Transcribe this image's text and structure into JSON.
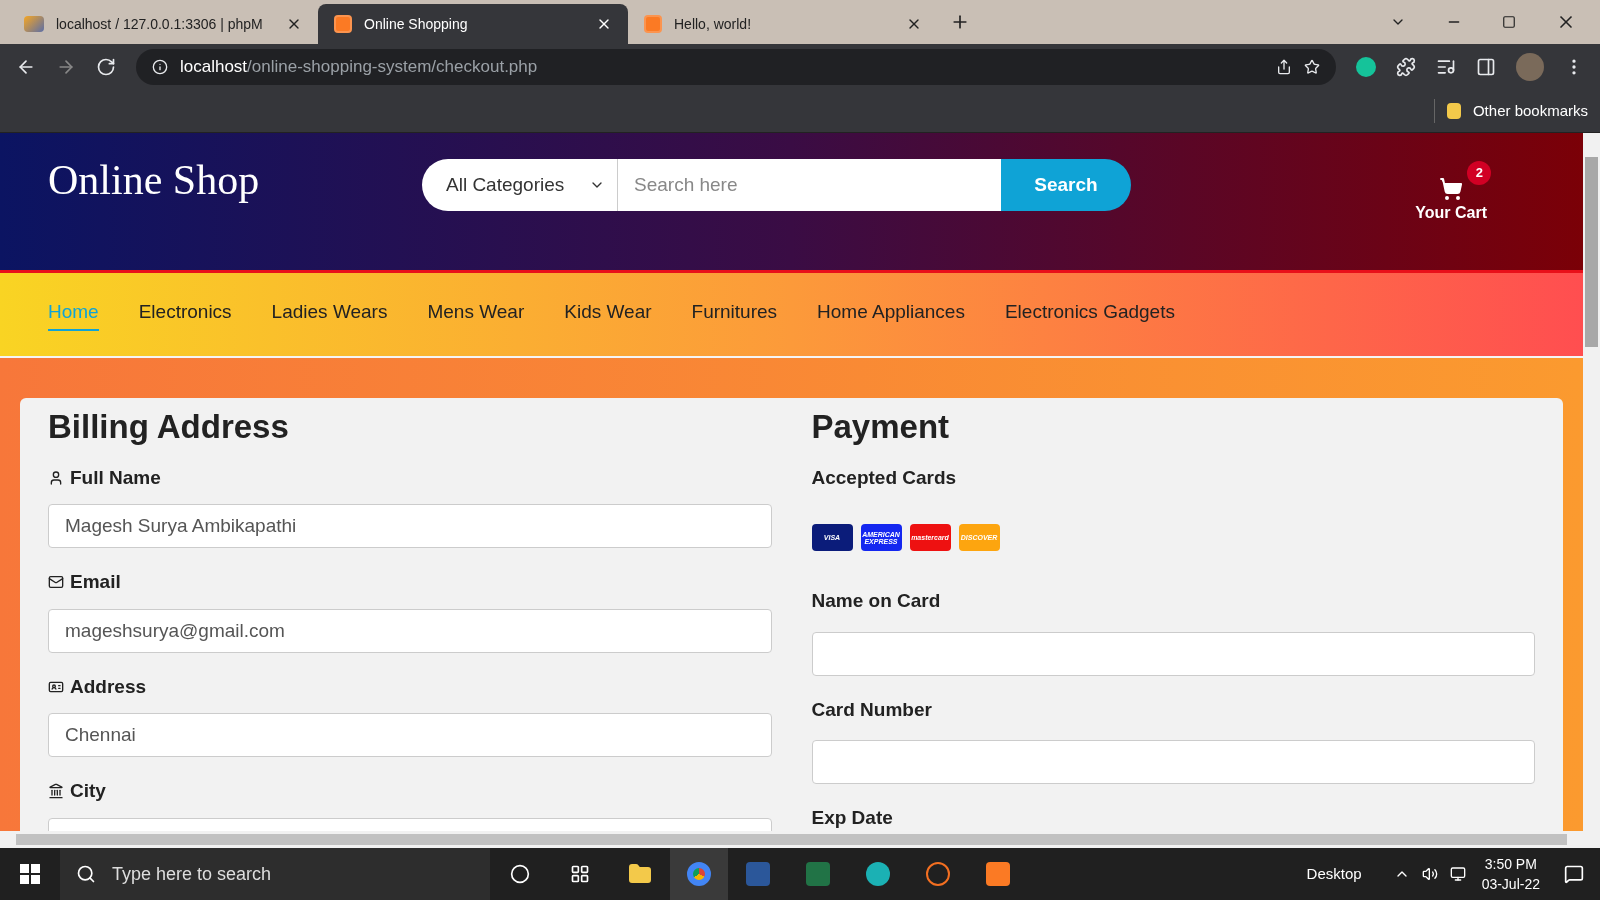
{
  "browser": {
    "tabs": [
      {
        "title": "localhost / 127.0.0.1:3306 | phpM",
        "kind": "pma",
        "selected": false
      },
      {
        "title": "Online Shopping",
        "kind": "xampp",
        "selected": true
      },
      {
        "title": "Hello, world!",
        "kind": "xampp",
        "selected": false
      }
    ],
    "url_host": "localhost",
    "url_path": "/online-shopping-system/checkout.php",
    "bookmark": "Other bookmarks"
  },
  "header": {
    "logo": "Online Shop",
    "category": "All Categories",
    "search_placeholder": "Search here",
    "search_button": "Search",
    "cart_count": "2",
    "cart_label": "Your Cart"
  },
  "nav": [
    {
      "label": "Home",
      "selected": true
    },
    {
      "label": "Electronics",
      "selected": false
    },
    {
      "label": "Ladies Wears",
      "selected": false
    },
    {
      "label": "Mens Wear",
      "selected": false
    },
    {
      "label": "Kids Wear",
      "selected": false
    },
    {
      "label": "Furnitures",
      "selected": false
    },
    {
      "label": "Home Appliances",
      "selected": false
    },
    {
      "label": "Electronics Gadgets",
      "selected": false
    }
  ],
  "billing": {
    "title": "Billing Address",
    "fields": [
      {
        "label": "Full Name",
        "kind": "name",
        "value": "Magesh Surya Ambikapathi"
      },
      {
        "label": "Email",
        "kind": "email",
        "value": "mageshsurya@gmail.com"
      },
      {
        "label": "Address",
        "kind": "address",
        "value": "Chennai"
      },
      {
        "label": "City",
        "kind": "city"
      }
    ]
  },
  "payment": {
    "title": "Payment",
    "accepted": "Accepted Cards",
    "cards": [
      {
        "label": "VISA",
        "color": "#0b1c7a"
      },
      {
        "label": "AMERICAN EXPRESS",
        "color": "#1427f0"
      },
      {
        "label": "mastercard",
        "color": "#ee1111"
      },
      {
        "label": "DISCOVER",
        "color": "#fda50f"
      }
    ],
    "fields": [
      {
        "label": "Name on Card",
        "kind": "input"
      },
      {
        "label": "Card Number",
        "kind": "input"
      },
      {
        "label": "Exp Date",
        "kind": "label"
      }
    ]
  },
  "taskbar": {
    "search": "Type here to search",
    "desktop": "Desktop",
    "time": "3:50 PM",
    "date": "03-Jul-22"
  }
}
